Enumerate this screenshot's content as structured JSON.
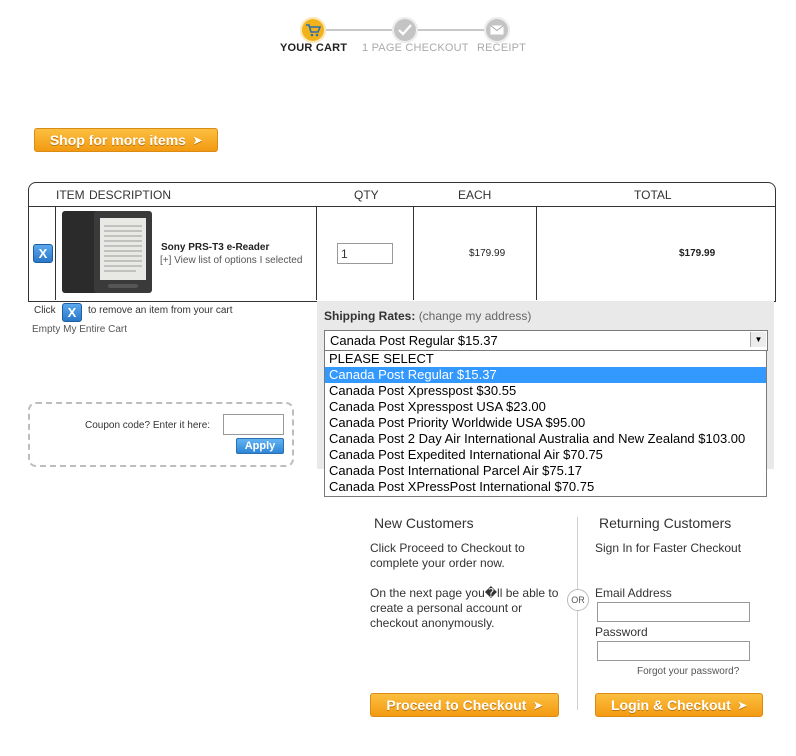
{
  "progress": {
    "steps": [
      {
        "label": "YOUR CART",
        "active": true,
        "color": "#f2b21b"
      },
      {
        "label": "1 PAGE CHECKOUT",
        "active": false,
        "color": "#bdbdbd"
      },
      {
        "label": "RECEIPT",
        "active": false,
        "color": "#bdbdbd"
      }
    ]
  },
  "shop_more_label": "Shop for more items",
  "cart": {
    "headers": {
      "item": "ITEM",
      "description": "DESCRIPTION",
      "qty": "QTY",
      "each": "EACH",
      "total": "TOTAL"
    },
    "items": [
      {
        "remove_label": "X",
        "name": "Sony PRS-T3 e-Reader",
        "options_link": "[+] View list of options I selected",
        "qty": "1",
        "each": "$179.99",
        "total": "$179.99"
      }
    ]
  },
  "remove_hint": {
    "before": "Click",
    "icon_label": "X",
    "after": "to remove an item from your cart"
  },
  "empty_cart_label": "Empty My Entire Cart",
  "coupon": {
    "label": "Coupon code? Enter it here:",
    "value": "",
    "apply_label": "Apply"
  },
  "shipping": {
    "label": "Shipping Rates:",
    "change_address_link": "(change my address)",
    "selected": "Canada Post Regular $15.37",
    "options": [
      "PLEASE SELECT",
      "Canada Post Regular $15.37",
      "Canada Post Xpresspost $30.55",
      "Canada Post Xpresspost USA $23.00",
      "Canada Post Priority Worldwide USA $95.00",
      "Canada Post 2 Day Air International Australia and New Zealand $103.00",
      "Canada Post Expedited International Air $70.75",
      "Canada Post International Parcel Air $75.17",
      "Canada Post XPressPost International $70.75"
    ],
    "highlighted_index": 1
  },
  "new_customers": {
    "title": "New Customers",
    "text1": "Click Proceed to Checkout to complete your order now.",
    "text2": "On the next page you�ll be able to create a personal account or checkout anonymously.",
    "button_label": "Proceed to Checkout"
  },
  "or_label": "OR",
  "returning_customers": {
    "title": "Returning Customers",
    "subtitle": "Sign In for Faster Checkout",
    "email_label": "Email Address",
    "email_value": "",
    "password_label": "Password",
    "password_value": "",
    "forgot_link": "Forgot your password?",
    "button_label": "Login & Checkout"
  },
  "colors": {
    "accent_orange": "#f7a823",
    "blue_button": "#3a8ee0",
    "selected_option": "#3399ff"
  }
}
